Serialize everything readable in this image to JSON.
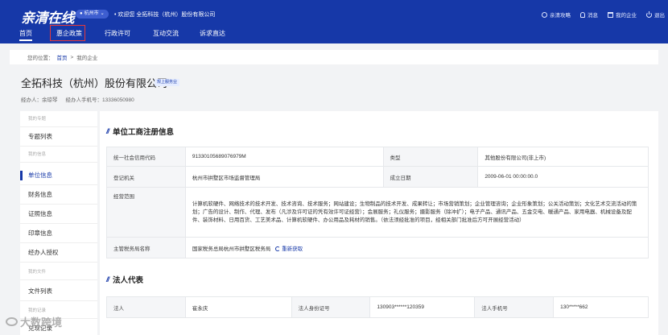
{
  "header": {
    "logo": "亲清在线",
    "city": "杭州市",
    "welcome": "欢迎您 全拓科技（杭州）股份有限公司",
    "links": [
      "亲清攻略",
      "消息",
      "我的企业",
      "退出"
    ]
  },
  "nav": {
    "items": [
      "首页",
      "惠企政策",
      "行政许可",
      "互动交流",
      "诉求直达"
    ]
  },
  "breadcrumb": {
    "prefix": "您的位置：",
    "home": "首页",
    "sep": ">",
    "current": "我的企业"
  },
  "company": {
    "name": "全拓科技（杭州）股份有限公司",
    "tag": "规上服务业",
    "agent_label": "经办人：余琼琴",
    "agent_phone": "经办人手机号：13336050980"
  },
  "sidebar": {
    "groups": [
      "我的专题",
      "我的信息",
      "我的文件",
      "我的记录"
    ],
    "items": [
      "专题列表",
      "单位信息",
      "财务信息",
      "证照信息",
      "印章信息",
      "经办人授权",
      "文件列表",
      "兑现记录"
    ]
  },
  "section1": {
    "title": "单位工商注册信息",
    "credit_code_label": "统一社会信用代码",
    "credit_code": "91330105689076979M",
    "type_label": "类型",
    "type": "其他股份有限公司(非上市)",
    "authority_label": "登记机关",
    "authority": "杭州市拱墅区市场监督管理局",
    "est_label": "成立日期",
    "est": "2009-06-01 00:00:00.0",
    "scope_label": "经营范围",
    "scope": "计算机软硬件、网络技术的技术开发、技术咨询、技术服务；网站建设；生物制品的技术开发、成果转让；市场营销策划；企业管理咨询；企业形象策划；公关活动策划；文化艺术交流活动的策划；广告的设计、制作、代理、发布（凡涉及许可证的凭有效许可证经营）；会展服务；礼仪服务；摄影服务（除冲扩）；电子产品、通讯产品、五金交电、暖通产品、家用电器、机械设备及配件、装饰材料、日用百货、工艺美术品、计算机软硬件、办公用品及耗材的销售。（依法须经批准的项目，经相关部门批准后方可开展经营活动）",
    "tax_label": "主管税务局名称",
    "tax": "国家税务总局杭州市拱墅区税务局",
    "refresh": "重新获取"
  },
  "section2": {
    "title": "法人代表",
    "legal_label": "法人",
    "legal": "崔永庆",
    "id_label": "法人身份证号",
    "id": "130903******120359",
    "phone_label": "法人手机号",
    "phone": "130*****662"
  },
  "watermark": "大数跨境"
}
